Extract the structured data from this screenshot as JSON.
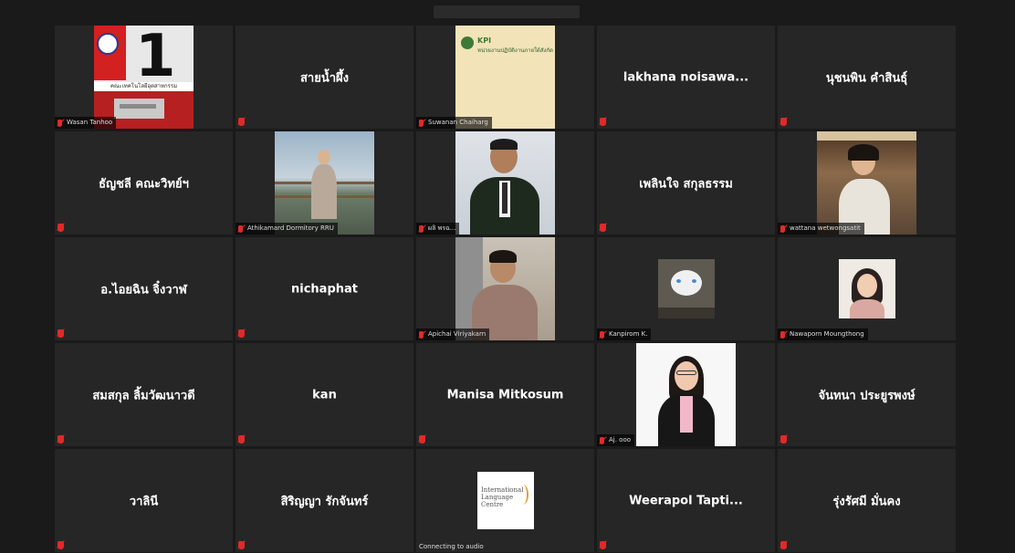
{
  "participants": [
    {
      "name": "Wasan Tanhoo",
      "type": "image",
      "big_number": "1",
      "caption": "คณะเทคโนโลยีอุตสาหกรรม"
    },
    {
      "name": "สายน้ำผึ้ง",
      "type": "name"
    },
    {
      "name": "Suwanan Chaiharg",
      "type": "logo",
      "logo_title": "KPI",
      "logo_caption": "หน่วยงานปฏิบัติงานภายใต้สังกัด"
    },
    {
      "name": "lakhana  noisawa...",
      "type": "name"
    },
    {
      "name": "นุชนพิน  คำสินธุ์",
      "type": "name"
    },
    {
      "name": "ธัญชลี  คณะวิทย์ฯ",
      "type": "name"
    },
    {
      "name": "Athikamard Dormitory RRU",
      "type": "video"
    },
    {
      "name": "ผลิ พรฉ...",
      "type": "video"
    },
    {
      "name": "เพลินใจ  สกุลธรรม",
      "type": "name"
    },
    {
      "name": "wattana wetwongsatit",
      "type": "video"
    },
    {
      "name": "อ.ไอยฉิน  จิ๋งวาฬ",
      "type": "name"
    },
    {
      "name": "nichaphat",
      "type": "name"
    },
    {
      "name": "Apichai Viriyakarn",
      "type": "video"
    },
    {
      "name": "Kanpirom K.",
      "type": "video"
    },
    {
      "name": "Nawaporn Moungthong",
      "type": "video"
    },
    {
      "name": "สมสกุล  ลิ้มวัฒนาวดี",
      "type": "name"
    },
    {
      "name": "kan",
      "type": "name"
    },
    {
      "name": "Manisa Mitkosum",
      "type": "name"
    },
    {
      "name": "Aj. ooo",
      "type": "video"
    },
    {
      "name": "จันทนา  ประยูรพงษ์",
      "type": "name"
    },
    {
      "name": "วาลินี",
      "type": "name"
    },
    {
      "name": "สิริญญา  รักจันทร์",
      "type": "name"
    },
    {
      "name": "Connecting to audio",
      "type": "logo2",
      "logo_lines": [
        "International",
        "Language",
        "Centre"
      ]
    },
    {
      "name": "Weerapol  Tapti...",
      "type": "name"
    },
    {
      "name": "รุ่งรัศมี  มั่นคง",
      "type": "name"
    }
  ],
  "colors": {
    "tile_bg": "#262626",
    "mute": "#e02a2a"
  }
}
